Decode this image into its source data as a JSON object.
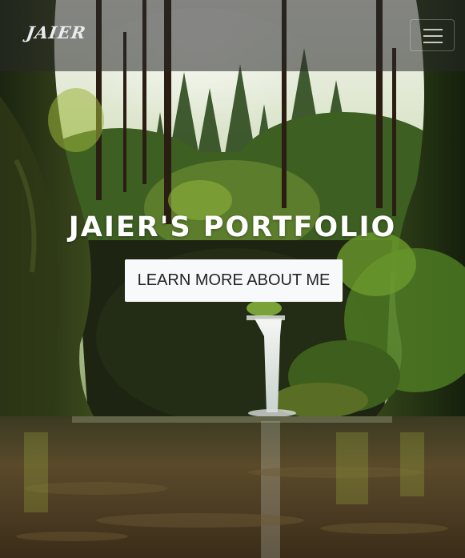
{
  "navbar": {
    "brand": "JAIER",
    "menu_icon": "hamburger-menu-icon"
  },
  "hero": {
    "title": "JAIER'S PORTFOLIO",
    "cta_label": "LEARN MORE ABOUT ME",
    "background": "forest-waterfall-photo"
  },
  "colors": {
    "navbar_bg": "#282828",
    "button_bg": "#f8f9fa",
    "button_text": "#212529",
    "title_text": "#ffffff"
  }
}
